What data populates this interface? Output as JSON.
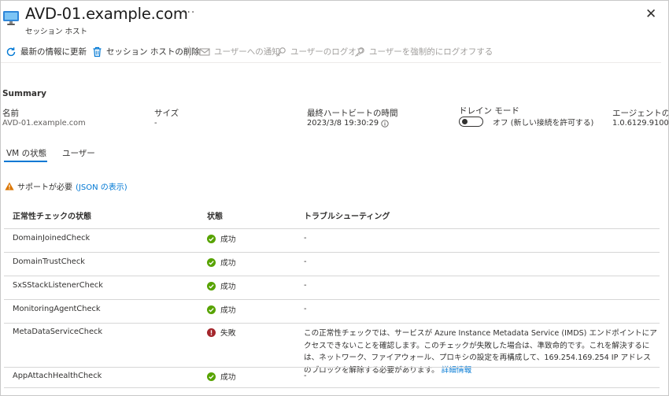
{
  "header": {
    "title": "AVD-01.example.com",
    "subtitle": "セッション ホスト",
    "more": "···",
    "close": "✕"
  },
  "toolbar": {
    "refresh": "最新の情報に更新",
    "delete": "セッション ホストの削除",
    "notify": "ユーザーへの通知",
    "logoff": "ユーザーのログオフ",
    "force_logoff": "ユーザーを強制的にログオフする"
  },
  "summary": {
    "heading": "Summary",
    "name_label": "名前",
    "name_value": "AVD-01.example.com",
    "size_label": "サイズ",
    "size_value": "-",
    "heartbeat_label": "最終ハートビートの時間",
    "heartbeat_value": "2023/3/8 19:30:29",
    "drain_label": "ドレイン モード",
    "drain_value": "オフ (新しい接続を許可する)",
    "agent_label": "エージェントのバー",
    "agent_value": "1.0.6129.9100"
  },
  "tabs": [
    "VM の状態",
    "ユーザー"
  ],
  "warning": {
    "text": "サポートが必要",
    "link": "(JSON の表示)"
  },
  "table": {
    "headers": [
      "正常性チェックの状態",
      "状態",
      "トラブルシューティング"
    ],
    "rows": [
      {
        "name": "DomainJoinedCheck",
        "status": "成功",
        "result": "success",
        "trouble": "-"
      },
      {
        "name": "DomainTrustCheck",
        "status": "成功",
        "result": "success",
        "trouble": "-"
      },
      {
        "name": "SxSStackListenerCheck",
        "status": "成功",
        "result": "success",
        "trouble": "-"
      },
      {
        "name": "MonitoringAgentCheck",
        "status": "成功",
        "result": "success",
        "trouble": "-"
      },
      {
        "name": "MetaDataServiceCheck",
        "status": "失敗",
        "result": "failure",
        "trouble": ""
      },
      {
        "name": "AppAttachHealthCheck",
        "status": "成功",
        "result": "success",
        "trouble": "-"
      }
    ],
    "failure_text": "この正常性チェックでは、サービスが Azure Instance Metadata Service (IMDS) エンドポイントにアクセスできないことを確認します。このチェックが失敗した場合は、準致命的です。これを解決するには、ネットワーク、ファイアウォール、プロキシの設定を再構成して、169.254.169.254 IP アドレスのブロックを解除する必要があります。",
    "failure_link": "詳細情報"
  },
  "colors": {
    "accent": "#0078d4",
    "success": "#57a300",
    "failure": "#a4262c",
    "warning": "#db7500"
  },
  "icons": {
    "title": "virtual-machine-icon",
    "refresh": "refresh-icon",
    "delete": "trash-icon",
    "notify": "mail-icon",
    "logoff": "key-icon",
    "force_logoff": "key-icon",
    "warning": "warning-triangle-icon",
    "info": "info-icon",
    "success": "check-circle-icon",
    "failure": "error-circle-icon"
  }
}
